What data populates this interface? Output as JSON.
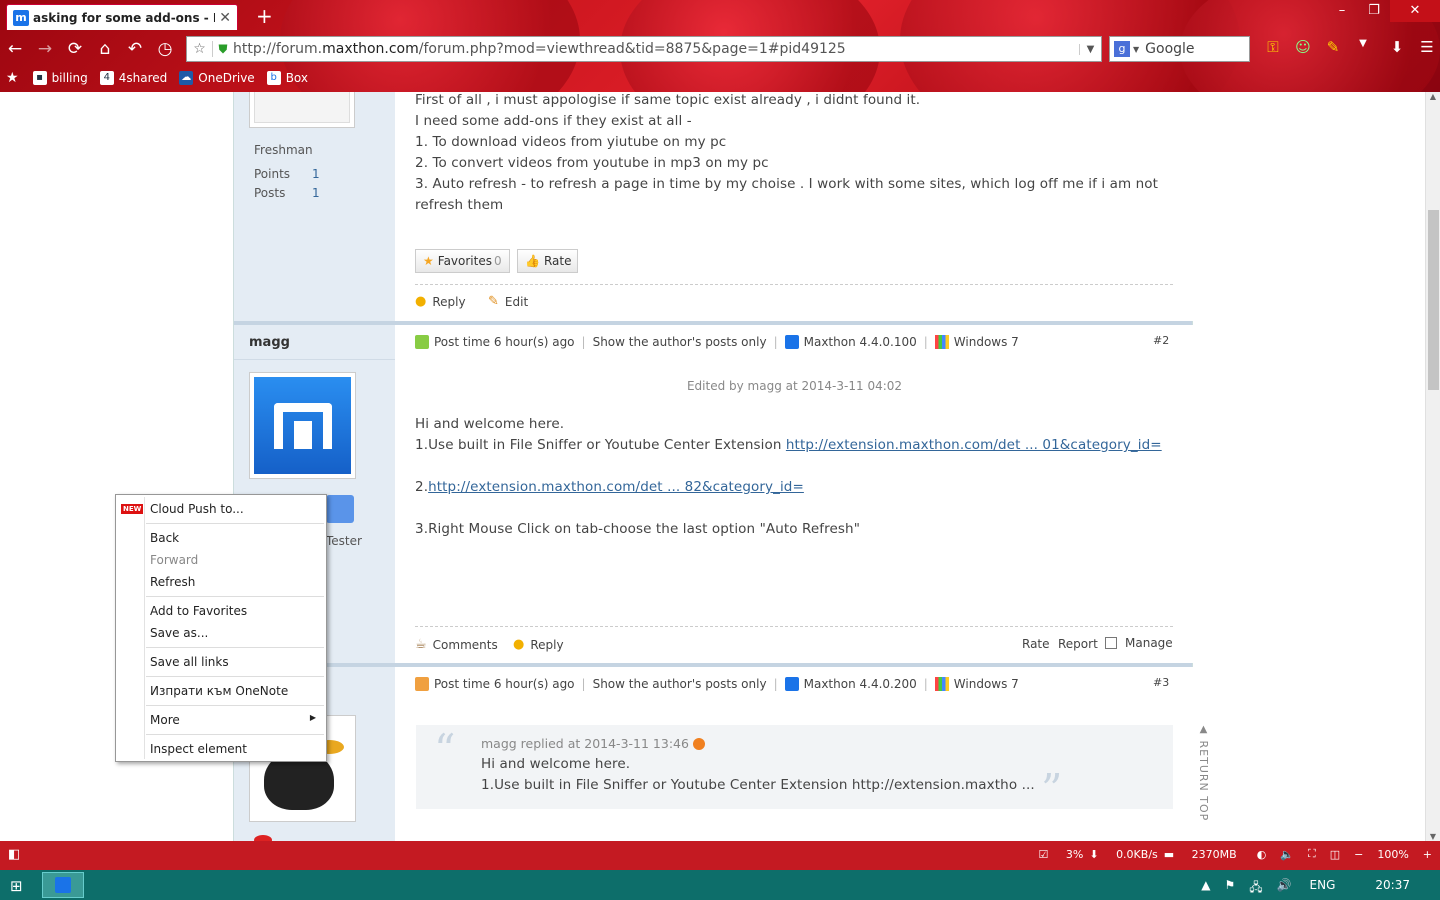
{
  "browser": {
    "tab_title": "asking for some add-ons - Brow...",
    "url_prefix": "http://forum.",
    "url_domain": "maxthon.com",
    "url_suffix": "/forum.php?mod=viewthread&tid=8875&page=1#pid49125",
    "search_engine": "Google",
    "bookmarks": [
      "billing",
      "4shared",
      "OneDrive",
      "Box"
    ]
  },
  "post1": {
    "rank": "Freshman",
    "points_label": "Points",
    "points_value": "1",
    "posts_label": "Posts",
    "posts_value": "1",
    "lines": [
      "First of all , i must appologise if same topic exist already , i didnt found it.",
      "I need some add-ons if they exist at all -",
      "1. To download videos from yiutube on my pc",
      "2. To convert videos from youtube in mp3 on my pc",
      "3. Auto refresh - to refresh a page in time by my choise . I work with some sites, which log off me if i am not",
      "refresh them"
    ],
    "favorites_label": "Favorites",
    "favorites_count": "0",
    "rate_label": "Rate",
    "reply_label": "Reply",
    "edit_label": "Edit"
  },
  "post2": {
    "author": "magg",
    "tester_label": "Tester",
    "post_time": "Post time 6 hour(s) ago",
    "author_only": "Show the author's posts only",
    "browser_ver": "Maxthon 4.4.0.100",
    "os": "Windows 7",
    "floor": "#2",
    "edited": "Edited by magg at 2014-3-11 04:02",
    "line1": "Hi and welcome here.",
    "line2_text": "1.Use built in File Sniffer or Youtube Center Extension ",
    "line2_link": "http://extension.maxthon.com/det ... 01&category_id=",
    "line3_text": "2.",
    "line3_link": "http://extension.maxthon.com/det ... 82&category_id=",
    "line4": "3.Right Mouse Click on tab-choose the last option \"Auto Refresh\"",
    "comments_label": "Comments",
    "reply_label": "Reply",
    "rate_label": "Rate",
    "report_label": "Report",
    "manage_label": "Manage"
  },
  "post3": {
    "post_time": "Post time 6 hour(s) ago",
    "author_only": "Show the author's posts only",
    "browser_ver": "Maxthon 4.4.0.200",
    "os": "Windows 7",
    "floor": "#3",
    "quote_head": "magg replied at 2014-3-11 13:46",
    "quote_line1": "Hi and welcome here.",
    "quote_line2": "1.Use built in File Sniffer or Youtube Center Extension http://extension.maxtho ..."
  },
  "return_top": "RETURN TOP",
  "context_menu": {
    "new_badge": "NEW",
    "cloud_push": "Cloud Push to...",
    "back": "Back",
    "forward": "Forward",
    "refresh": "Refresh",
    "add_favorites": "Add to Favorites",
    "save_as": "Save as...",
    "save_links": "Save all links",
    "onenote": "Изпрати към OneNote",
    "more": "More",
    "inspect": "Inspect element"
  },
  "status_bar": {
    "cpu": "3%",
    "net": "0.0KB/s",
    "mem": "2370MB",
    "zoom": "100%"
  },
  "taskbar": {
    "lang": "ENG",
    "time": "20:37"
  }
}
